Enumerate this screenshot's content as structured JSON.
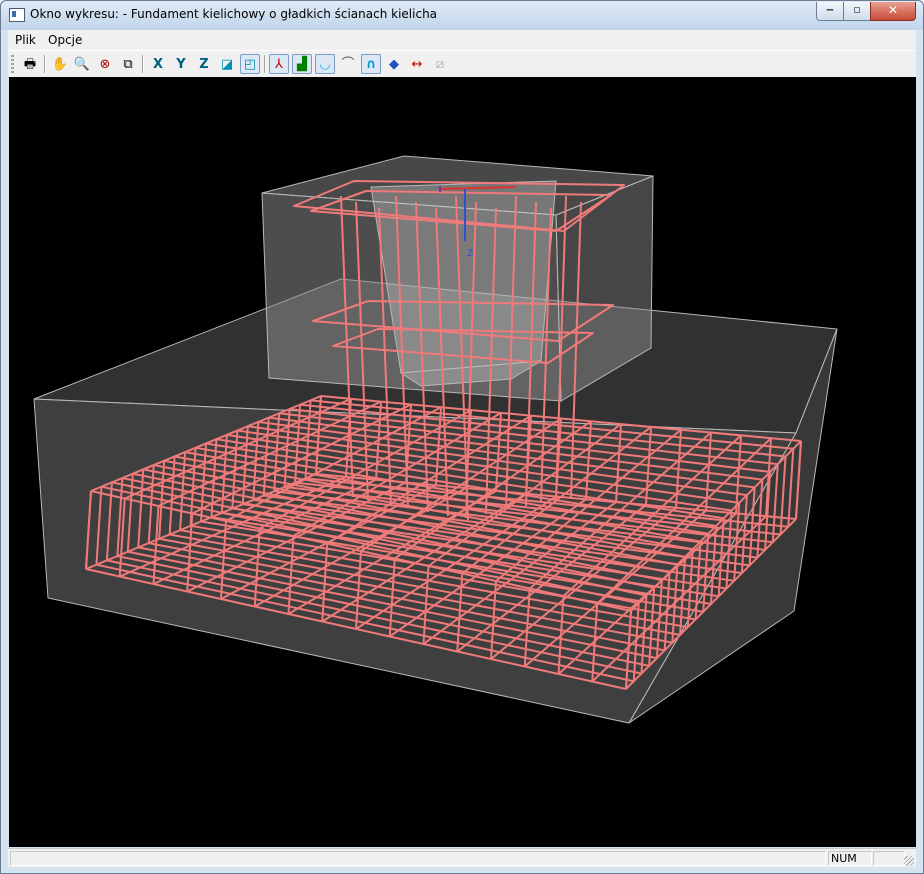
{
  "window": {
    "title": "Okno wykresu: - Fundament kielichowy o gładkich ścianach kielicha",
    "minimize_glyph": "‒",
    "maximize_glyph": "▫",
    "close_glyph": "✕"
  },
  "menu": [
    {
      "label": "Plik"
    },
    {
      "label": "Opcje"
    }
  ],
  "toolbar": {
    "buttons": [
      {
        "name": "print-icon",
        "glyph": "🖶"
      },
      {
        "name": "pan-hand-icon",
        "glyph": "✋"
      },
      {
        "name": "zoom-icon",
        "glyph": "🔍"
      },
      {
        "name": "zoom-cancel-icon",
        "glyph": "⊗"
      },
      {
        "name": "zoom-window-icon",
        "glyph": "⧉"
      },
      {
        "name": "view-x-icon",
        "glyph": "X"
      },
      {
        "name": "view-y-icon",
        "glyph": "Y"
      },
      {
        "name": "view-z-icon",
        "glyph": "Z"
      },
      {
        "name": "view-iso-icon",
        "glyph": "◪"
      },
      {
        "name": "view-3d-icon",
        "glyph": "◰"
      },
      {
        "name": "axes-icon",
        "glyph": "⅄"
      },
      {
        "name": "foundation-icon",
        "glyph": "▟"
      },
      {
        "name": "bottom-bars-icon",
        "glyph": "◡"
      },
      {
        "name": "hook-bars-icon",
        "glyph": "⌒"
      },
      {
        "name": "stirrup-icon",
        "glyph": "∩"
      },
      {
        "name": "solid-icon",
        "glyph": "◆"
      },
      {
        "name": "dimension-icon",
        "glyph": "↔"
      },
      {
        "name": "hatch-icon",
        "glyph": "⧄"
      }
    ]
  },
  "viewport": {
    "background": "#000000",
    "rebar_color": "#f07a7a",
    "concrete_edge_color": "#b8b8b8",
    "concrete_fill_color": "#5a5a5a",
    "axis_x_color": "#e03030",
    "axis_y_color": "#8030a0",
    "axis_z_color": "#3050d0",
    "axis_z_label": "Z"
  },
  "statusbar": {
    "main_text": "",
    "num_indicator": "NUM"
  }
}
